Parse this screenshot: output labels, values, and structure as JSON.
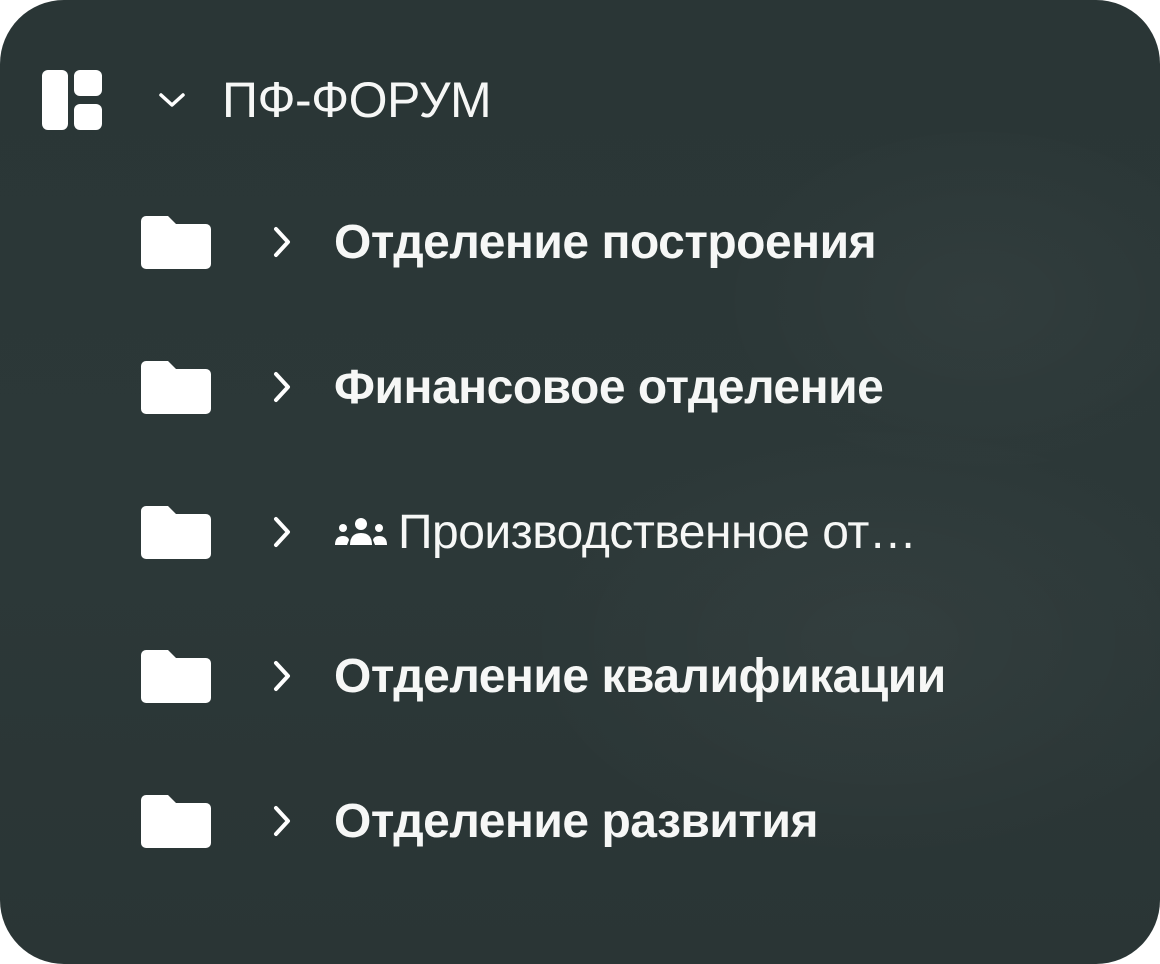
{
  "tree": {
    "root": {
      "label": "ПФ-ФОРУМ",
      "icon": "space-layout-icon",
      "expanded": true
    },
    "items": [
      {
        "label": "Отделение построения",
        "icon": "folder-icon",
        "expanded": false
      },
      {
        "label": "Финансовое отделение",
        "icon": "folder-icon",
        "expanded": false
      },
      {
        "label": "Производственное от…",
        "icon": "folder-icon",
        "shared_icon": "group-icon",
        "expanded": false
      },
      {
        "label": "Отделение квалификации",
        "icon": "folder-icon",
        "expanded": false
      },
      {
        "label": "Отделение развития",
        "icon": "folder-icon",
        "expanded": false
      }
    ]
  },
  "colors": {
    "background": "#2b3737",
    "text": "#f6f7f6",
    "icon": "#ffffff"
  }
}
